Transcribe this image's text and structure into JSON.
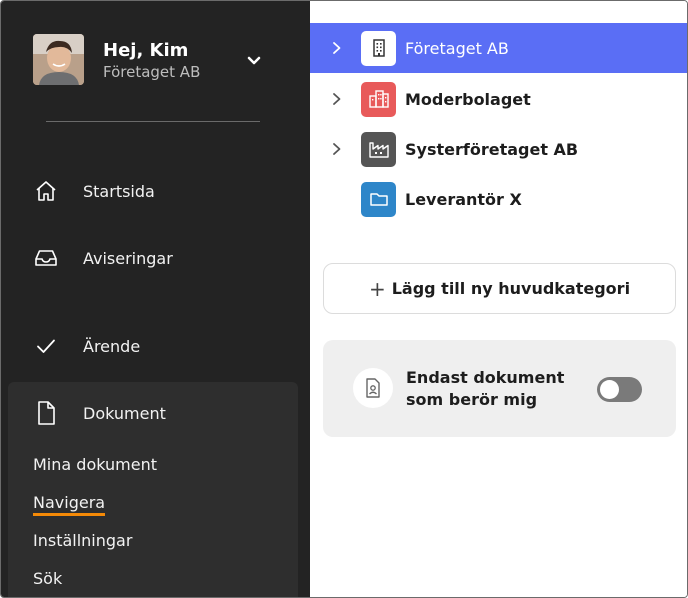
{
  "profile": {
    "greeting": "Hej, Kim",
    "company": "Företaget AB"
  },
  "nav": {
    "items": [
      {
        "label": "Startsida",
        "icon": "home-icon"
      },
      {
        "label": "Aviseringar",
        "icon": "inbox-icon"
      },
      {
        "label": "Ärende",
        "icon": "check-icon"
      },
      {
        "label": "Dokument",
        "icon": "document-icon"
      }
    ],
    "document_sub": [
      {
        "label": "Mina dokument"
      },
      {
        "label": "Navigera",
        "active": true
      },
      {
        "label": "Inställningar"
      },
      {
        "label": "Sök"
      }
    ],
    "active_underline_color": "#f58a07"
  },
  "tree": {
    "items": [
      {
        "label": "Företaget AB",
        "icon": "building-icon",
        "icon_bg": "#ffffff",
        "selected": true,
        "expandable": true
      },
      {
        "label": "Moderbolaget",
        "icon": "city-buildings-icon",
        "icon_bg": "#e85a5a",
        "selected": false,
        "expandable": true
      },
      {
        "label": "Systerföretaget AB",
        "icon": "factory-icon",
        "icon_bg": "#555555",
        "selected": false,
        "expandable": true
      },
      {
        "label": "Leverantör X",
        "icon": "folder-icon",
        "icon_bg": "#2e86c9",
        "selected": false,
        "expandable": false
      }
    ],
    "selected_color": "#5a6ef5"
  },
  "actions": {
    "add_category": "Lägg till ny huvudkategori"
  },
  "filter": {
    "label": "Endast dokument som berör mig",
    "enabled": false
  }
}
